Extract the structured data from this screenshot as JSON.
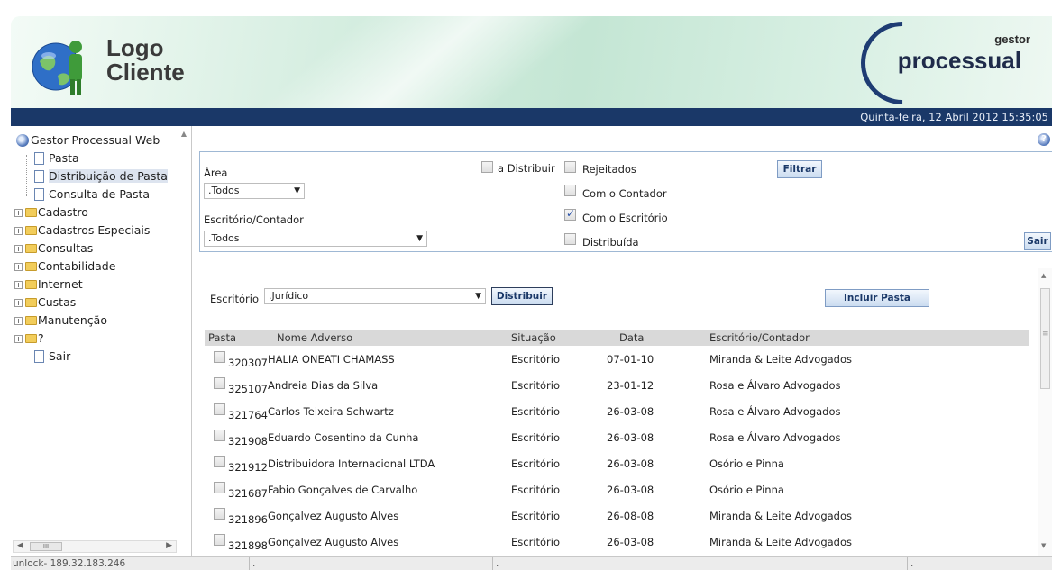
{
  "header": {
    "logo_line1": "Logo",
    "logo_line2": "Cliente",
    "brand_sub": "gestor",
    "brand_main": "processual",
    "date": "Quinta-feira, 12 Abril 2012 15:35:05"
  },
  "sidebar": {
    "root": "Gestor Processual Web",
    "items": [
      {
        "label": "Pasta",
        "kind": "page"
      },
      {
        "label": "Distribuição de Pasta",
        "kind": "page",
        "selected": true
      },
      {
        "label": "Consulta de Pasta",
        "kind": "page"
      },
      {
        "label": "Cadastro",
        "kind": "folder"
      },
      {
        "label": "Cadastros Especiais",
        "kind": "folder"
      },
      {
        "label": "Consultas",
        "kind": "folder"
      },
      {
        "label": "Contabilidade",
        "kind": "folder"
      },
      {
        "label": "Internet",
        "kind": "folder"
      },
      {
        "label": "Custas",
        "kind": "folder"
      },
      {
        "label": "Manutenção",
        "kind": "folder"
      },
      {
        "label": "?",
        "kind": "folder"
      },
      {
        "label": "Sair",
        "kind": "page"
      }
    ],
    "hscroll_thumb": "III"
  },
  "filters": {
    "area_label": "Área",
    "area_value": ".Todos",
    "escritorio_label": "Escritório/Contador",
    "escritorio_value": ".Todos",
    "checkboxes": {
      "a_distribuir": {
        "label": "a Distribuir",
        "checked": false
      },
      "rejeitados": {
        "label": "Rejeitados",
        "checked": false
      },
      "com_contador": {
        "label": "Com o Contador",
        "checked": false
      },
      "com_escritorio": {
        "label": "Com o Escritório",
        "checked": true
      },
      "distribuida": {
        "label": "Distribuída",
        "checked": false
      }
    },
    "filtrar_label": "Filtrar",
    "sair_label": "Sair"
  },
  "actions": {
    "escritorio_label": "Escritório",
    "escritorio_value": ".Jurídico",
    "distribuir_label": "Distribuir",
    "incluir_label": "Incluir Pasta"
  },
  "table": {
    "columns": [
      "Pasta",
      "Nome Adverso",
      "Situação",
      "Data",
      "Escritório/Contador"
    ],
    "rows": [
      {
        "pasta": "320307",
        "nome": "HALIA ONEATI CHAMASS",
        "situacao": "Escritório",
        "data": "07-01-10",
        "escritorio": "Miranda & Leite Advogados"
      },
      {
        "pasta": "325107",
        "nome": "Andreia Dias da Silva",
        "situacao": "Escritório",
        "data": "23-01-12",
        "escritorio": "Rosa e Álvaro Advogados"
      },
      {
        "pasta": "321764",
        "nome": "Carlos Teixeira Schwartz",
        "situacao": "Escritório",
        "data": "26-03-08",
        "escritorio": "Rosa e Álvaro Advogados"
      },
      {
        "pasta": "321908",
        "nome": "Eduardo Cosentino da Cunha",
        "situacao": "Escritório",
        "data": "26-03-08",
        "escritorio": "Rosa e Álvaro Advogados"
      },
      {
        "pasta": "321912",
        "nome": "Distribuidora Internacional LTDA",
        "situacao": "Escritório",
        "data": "26-03-08",
        "escritorio": "Osório e Pinna"
      },
      {
        "pasta": "321687",
        "nome": "Fabio Gonçalves de Carvalho",
        "situacao": "Escritório",
        "data": "26-03-08",
        "escritorio": "Osório e Pinna"
      },
      {
        "pasta": "321896",
        "nome": "Gonçalvez Augusto Alves",
        "situacao": "Escritório",
        "data": "26-08-08",
        "escritorio": "Miranda & Leite Advogados"
      },
      {
        "pasta": "321898",
        "nome": "Gonçalvez Augusto Alves",
        "situacao": "Escritório",
        "data": "26-03-08",
        "escritorio": "Miranda & Leite Advogados"
      }
    ]
  },
  "status": {
    "left": "unlock- 189.32.183.246",
    "seg2": ".",
    "seg3": ".",
    "seg4": "."
  },
  "colors": {
    "navy": "#1a3868",
    "header_green": "#c4e6d4",
    "table_header": "#d9d9d9"
  }
}
